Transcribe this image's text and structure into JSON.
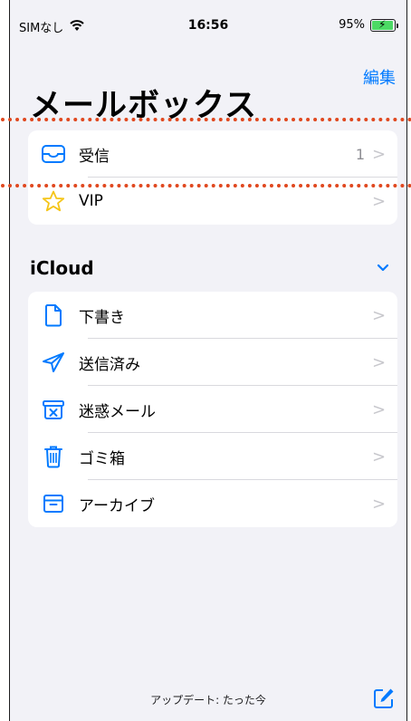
{
  "status_bar": {
    "carrier": "SIMなし",
    "time": "16:56",
    "battery_percent": "95%",
    "battery_level": 0.95
  },
  "nav": {
    "edit_label": "編集"
  },
  "title": "メールボックス",
  "mailboxes": [
    {
      "label": "受信",
      "count": "1",
      "icon": "inbox-icon"
    },
    {
      "label": "VIP",
      "count": "",
      "icon": "star-icon"
    }
  ],
  "icloud": {
    "header": "iCloud",
    "items": [
      {
        "label": "下書き",
        "icon": "document-icon"
      },
      {
        "label": "送信済み",
        "icon": "paper-plane-icon"
      },
      {
        "label": "迷惑メール",
        "icon": "junk-icon"
      },
      {
        "label": "ゴミ箱",
        "icon": "trash-icon"
      },
      {
        "label": "アーカイブ",
        "icon": "archive-icon"
      }
    ]
  },
  "footer": {
    "update_text": "アップデート: たった今"
  },
  "colors": {
    "accent": "#007aff",
    "annotation": "#e0481f",
    "battery": "#4cd964",
    "vip": "#f5c518"
  }
}
